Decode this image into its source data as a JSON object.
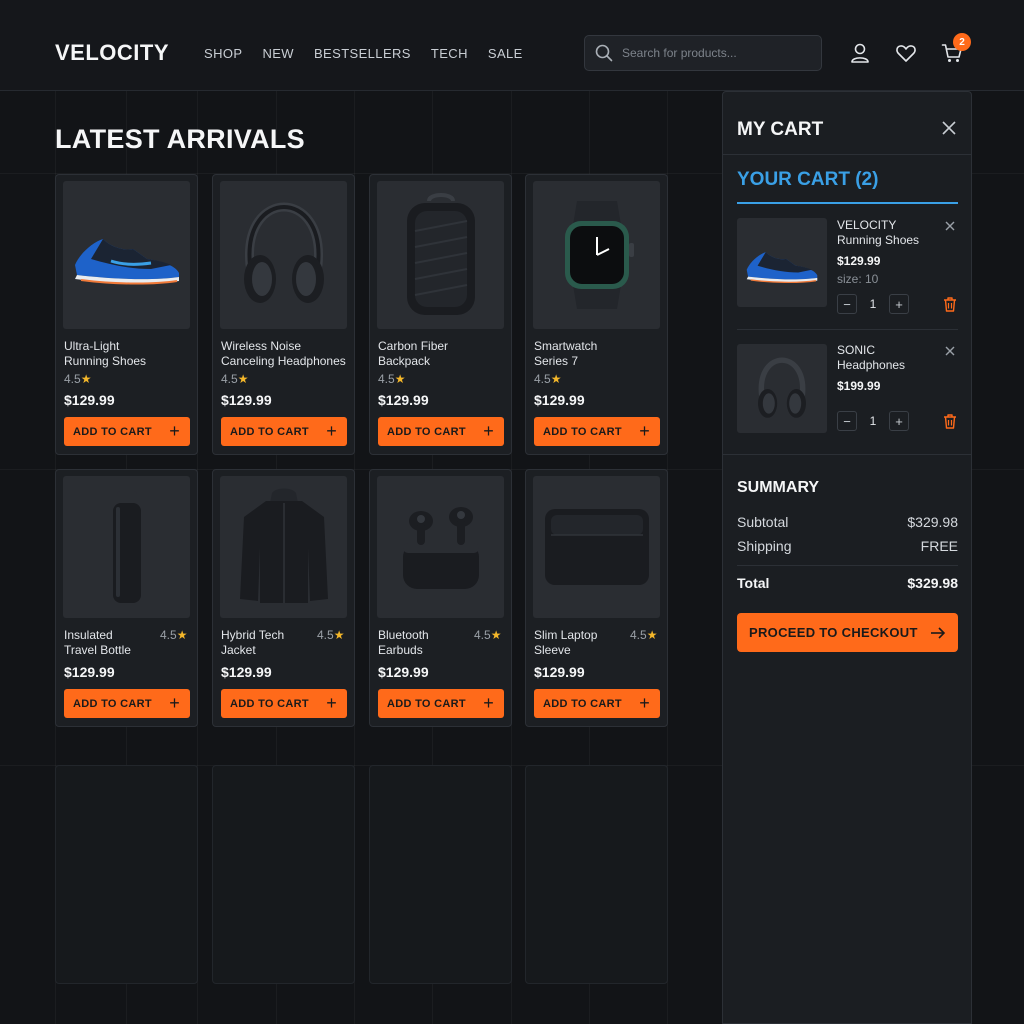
{
  "header": {
    "logo": "VELOCITY",
    "nav": [
      "SHOP",
      "NEW",
      "BESTSELLERS",
      "TECH",
      "SALE"
    ],
    "search_placeholder": "Search for products...",
    "icons": [
      "user-icon",
      "heart-icon",
      "cart-icon"
    ],
    "cart_count": "2"
  },
  "section_title": "LATEST ARRIVALS",
  "products": [
    {
      "name_line1": "Ultra-Light",
      "name_line2": "Running Shoes",
      "rating": "4.5",
      "price": "$129.99",
      "button": "ADD TO CART",
      "icon": "shoe-icon"
    },
    {
      "name_line1": "Wireless Noise",
      "name_line2": "Canceling Headphones",
      "rating": "4.5",
      "price": "$129.99",
      "button": "ADD TO CART",
      "icon": "headphones-icon"
    },
    {
      "name_line1": "Carbon Fiber",
      "name_line2": "Backpack",
      "rating": "4.5",
      "price": "$129.99",
      "button": "ADD TO CART",
      "icon": "backpack-icon"
    },
    {
      "name_line1": "Smartwatch",
      "name_line2": "Series 7",
      "rating": "4.5",
      "price": "$129.99",
      "button": "ADD TO CART",
      "icon": "smartwatch-icon"
    },
    {
      "name_line1": "Insulated",
      "name_line2": "Travel Bottle",
      "rating": "4.5",
      "price": "$129.99",
      "button": "ADD TO CART",
      "icon": "bottle-icon"
    },
    {
      "name_line1": "Hybrid Tech",
      "name_line2": "Jacket",
      "rating": "4.5",
      "price": "$129.99",
      "button": "ADD TO CART",
      "icon": "jacket-icon"
    },
    {
      "name_line1": "Bluetooth",
      "name_line2": "Earbuds",
      "rating": "4.5",
      "price": "$129.99",
      "button": "ADD TO CART",
      "icon": "earbuds-icon"
    },
    {
      "name_line1": "Slim Laptop",
      "name_line2": "Sleeve",
      "rating": "4.5",
      "price": "$129.99",
      "button": "ADD TO CART",
      "icon": "laptop-sleeve-icon"
    }
  ],
  "cart": {
    "title": "MY CART",
    "subtitle": "YOUR CART (2)",
    "items": [
      {
        "name_line1": "VELOCITY",
        "name_line2": "Running Shoes",
        "price": "$129.99",
        "size": "size: 10",
        "qty": "1",
        "icon": "shoe-icon"
      },
      {
        "name_line1": "SONIC",
        "name_line2": "Headphones",
        "price": "$199.99",
        "size": "",
        "qty": "1",
        "icon": "headphones-icon"
      }
    ],
    "summary": {
      "title": "SUMMARY",
      "subtotal_label": "Subtotal",
      "subtotal": "$329.98",
      "shipping_label": "Shipping",
      "shipping": "FREE",
      "total_label": "Total",
      "total": "$329.98"
    },
    "checkout_label": "PROCEED TO CHECKOUT"
  },
  "colors": {
    "accent": "#ff6a1a",
    "link": "#3aa0e6",
    "star": "#f4b72a",
    "background": "#121417"
  }
}
